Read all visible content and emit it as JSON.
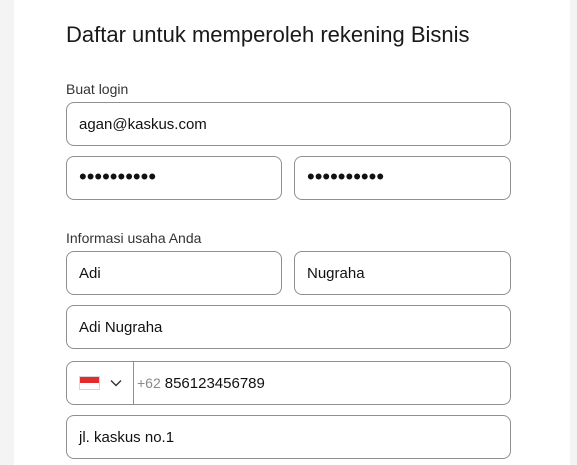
{
  "form": {
    "title": "Daftar untuk memperoleh rekening Bisnis",
    "login_section_label": "Buat login",
    "email_value": "agan@kaskus.com",
    "password_value": "••••••••••",
    "confirm_password_value": "••••••••••",
    "business_section_label": "Informasi usaha Anda",
    "first_name_value": "Adi",
    "last_name_value": "Nugraha",
    "business_name_value": "Adi Nugraha",
    "phone": {
      "country_flag": "indonesia-flag-icon",
      "prefix": "+62",
      "number": "856123456789"
    },
    "address_value": "jl. kaskus no.1"
  },
  "colors": {
    "border": "#8f8f8f",
    "text": "#111820",
    "flag_red": "#e12c2c"
  }
}
